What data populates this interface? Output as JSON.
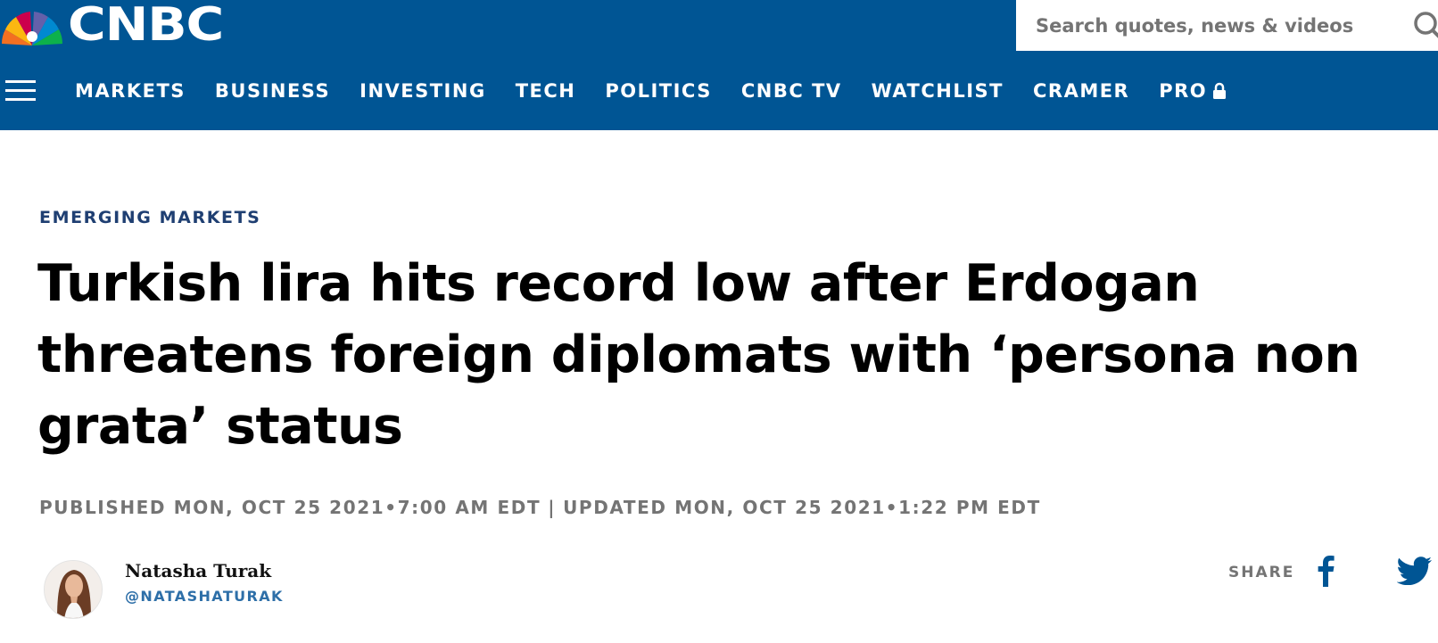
{
  "brand": {
    "name": "CNBC",
    "primary_color": "#005594"
  },
  "search": {
    "placeholder": "Search quotes, news & videos",
    "icon": "search-icon"
  },
  "nav": {
    "items": [
      {
        "label": "MARKETS"
      },
      {
        "label": "BUSINESS"
      },
      {
        "label": "INVESTING"
      },
      {
        "label": "TECH"
      },
      {
        "label": "POLITICS"
      },
      {
        "label": "CNBC TV"
      },
      {
        "label": "WATCHLIST"
      },
      {
        "label": "CRAMER"
      },
      {
        "label": "PRO",
        "icon": "lock-icon"
      }
    ]
  },
  "article": {
    "section": "EMERGING MARKETS",
    "headline": "Turkish lira hits record low after Erdogan threatens foreign diplomats with ‘persona non grata’ status",
    "published": "PUBLISHED MON, OCT 25 2021•7:00 AM EDT",
    "separator": "|",
    "updated": "UPDATED MON, OCT 25 2021•1:22 PM EDT"
  },
  "author": {
    "name": "Natasha Turak",
    "handle": "@NATASHATURAK"
  },
  "share": {
    "label": "SHARE",
    "icons": [
      "facebook-icon",
      "twitter-icon"
    ]
  }
}
